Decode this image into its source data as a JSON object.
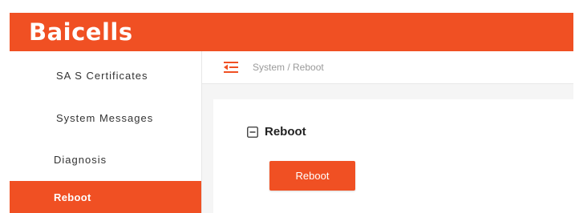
{
  "brand": {
    "logo_text": "Baicells",
    "accent_color": "#f05023"
  },
  "sidebar": {
    "items": [
      {
        "label": "SA S Certificates",
        "active": false
      },
      {
        "label": "System Messages",
        "active": false
      },
      {
        "label": "Diagnosis",
        "active": false
      },
      {
        "label": "Reboot",
        "active": true
      }
    ]
  },
  "header": {
    "menu_icon": "menu-fold-icon",
    "breadcrumb": "System / Reboot"
  },
  "main": {
    "section_title": "Reboot",
    "section_icon": "collapse-minus-icon",
    "reboot_button_label": "Reboot"
  }
}
